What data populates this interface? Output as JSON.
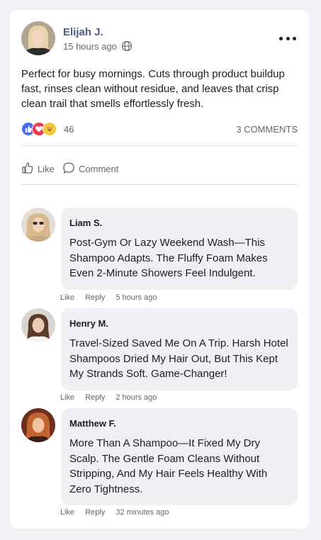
{
  "post": {
    "author": "Elijah J.",
    "time": "15 hours ago",
    "privacy_icon": "globe-icon",
    "text": "Perfect for busy mornings. Cuts through product buildup fast, rinses clean without residue, and leaves that crisp clean trail that smells effortlessly fresh.",
    "reaction_icons": [
      "like-reaction-icon",
      "love-reaction-icon",
      "haha-reaction-icon"
    ],
    "reaction_count": "46",
    "comments_count": "3 COMMENTS"
  },
  "actions": {
    "like_label": "Like",
    "comment_label": "Comment"
  },
  "comments": [
    {
      "author": "Liam S.",
      "text": "Post-Gym Or Lazy Weekend Wash—This Shampoo Adapts. The Fluffy Foam Makes Even 2-Minute Showers Feel Indulgent.",
      "like_label": "Like",
      "reply_label": "Reply",
      "time": "5 hours ago"
    },
    {
      "author": "Henry M.",
      "text": "Travel-Sized Saved Me On A Trip. Harsh Hotel Shampoos Dried My Hair Out, But This Kept My Strands Soft. Game-Changer!",
      "like_label": "Like",
      "reply_label": "Reply",
      "time": "2 hours ago"
    },
    {
      "author": "Matthew F.",
      "text": "More Than A Shampoo—It Fixed My Dry Scalp. The Gentle Foam Cleans Without Stripping, And My Hair Feels Healthy With Zero Tightness.",
      "like_label": "Like",
      "reply_label": "Reply",
      "time": "32 minutes ago"
    }
  ],
  "colors": {
    "author_name": "#4a5a8a",
    "like_reaction": "#4a6cf7",
    "love_reaction": "#f0394f",
    "haha_reaction": "#f7c53d"
  }
}
